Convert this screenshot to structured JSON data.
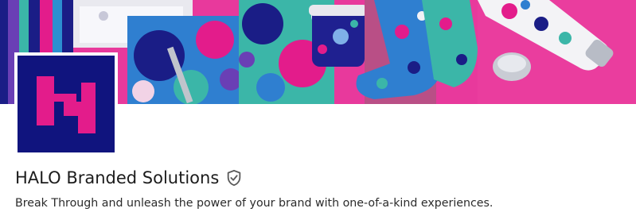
{
  "profile": {
    "name": "HALO Branded Solutions",
    "tagline": "Break Through and unleash the power of your brand with one-of-a-kind experiences."
  },
  "icons": {
    "verified": "verified-shield-icon",
    "logo": "halo-logo"
  },
  "colors": {
    "logo_background": "#10147e",
    "logo_mark": "#e31c8b",
    "cover_pink": "#e5389a",
    "text": "#1c1c1c"
  }
}
